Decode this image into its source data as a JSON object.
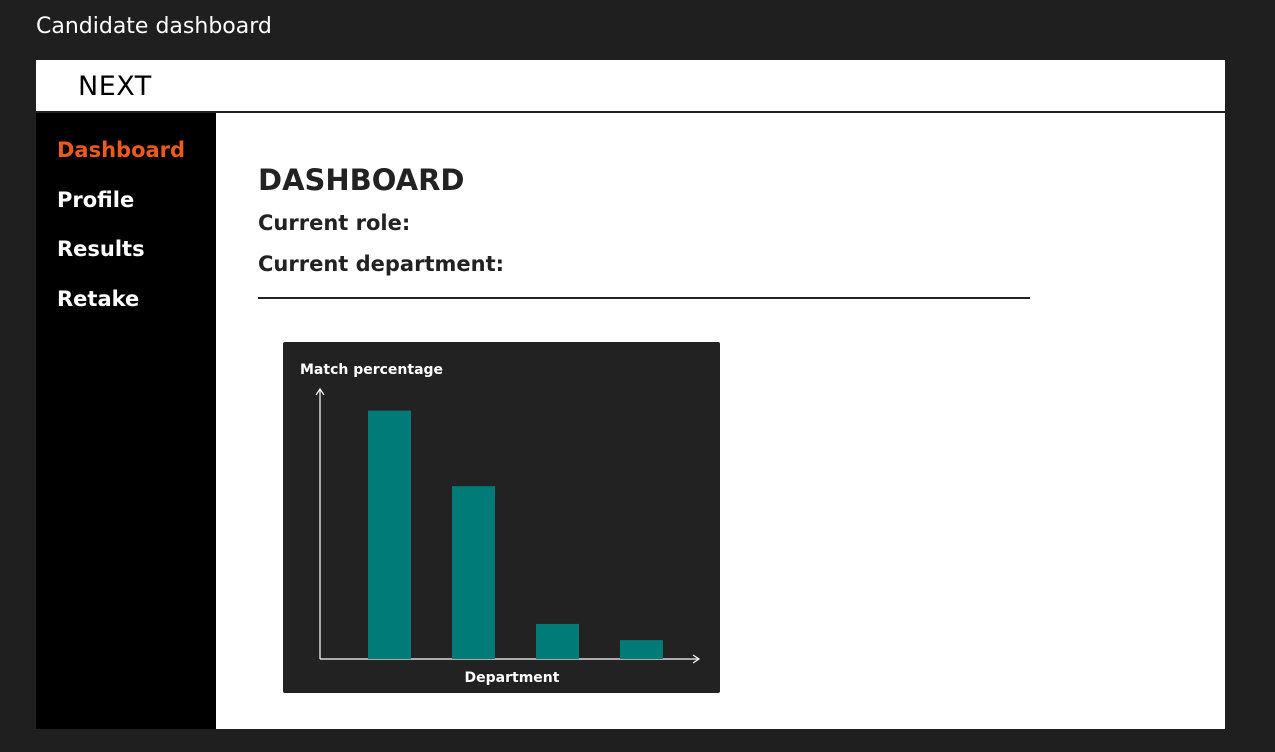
{
  "frame": {
    "title": "Candidate dashboard"
  },
  "header": {
    "logo": "NEXT"
  },
  "sidebar": {
    "items": [
      {
        "label": "Dashboard",
        "active": true
      },
      {
        "label": "Profile",
        "active": false
      },
      {
        "label": "Results",
        "active": false
      },
      {
        "label": "Retake",
        "active": false
      }
    ]
  },
  "main": {
    "title": "DASHBOARD",
    "current_role_label": "Current role:",
    "current_department_label": "Current department:"
  },
  "colors": {
    "accent": "#ec5a1e",
    "bar": "#007b78",
    "chart_bg": "#222222"
  },
  "chart_data": {
    "type": "bar",
    "ylabel": "Match percentage",
    "xlabel": "Department",
    "categories": [
      "",
      "",
      "",
      ""
    ],
    "values": [
      92,
      64,
      13,
      7
    ],
    "ylim": [
      0,
      100
    ],
    "grid": false
  }
}
